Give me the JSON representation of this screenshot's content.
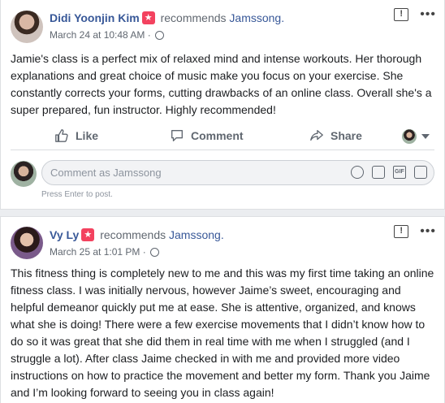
{
  "posts": [
    {
      "author": "Didi Yoonjin Kim",
      "action": "recommends",
      "page": "Jamssong.",
      "date": "March 24 at 10:48 AM",
      "separator": "·",
      "text": "Jamie's class is a perfect mix of relaxed mind and intense workouts. Her thorough explanations and great choice of music make you focus on your exercise. She constantly corrects your forms, cutting drawbacks of an online class. Overall she's a super prepared, fun instructor. Highly recommended!",
      "actions": {
        "like": "Like",
        "comment": "Comment",
        "share": "Share"
      },
      "comment_placeholder": "Comment as Jamssong",
      "comment_hint": "Press Enter to post."
    },
    {
      "author": "Vy Ly",
      "action": "recommends",
      "page": "Jamssong.",
      "date": "March 25 at 1:01 PM",
      "separator": "·",
      "text": "This fitness thing is completely new to me and this was my first time taking an online fitness class. I was initially nervous, however Jaime’s sweet, encouraging and helpful demeanor quickly put me at ease. She is attentive, organized, and knows what she is doing! There were a few exercise movements that I didn’t know how to do so it was great that she did them in real time with me when I struggled (and I struggle a lot). After class Jaime checked in with me and provided more video instructions on how to practice the movement and better my form. Thank you Jaime and I’m looking forward to seeing you in class again!"
    }
  ],
  "icons": {
    "report": "report-flag-icon",
    "more": "more-options-icon",
    "privacy": "globe-icon"
  },
  "colors": {
    "link": "#385898",
    "badge": "#f3425f",
    "text": "#1c1e21",
    "muted": "#606770",
    "background": "#ebedf0"
  }
}
